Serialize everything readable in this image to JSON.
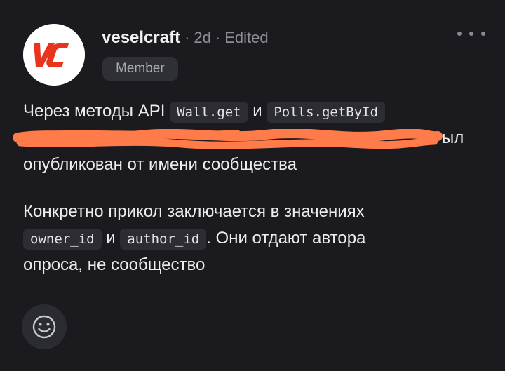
{
  "post": {
    "username": "veselcraft",
    "time": "2d",
    "edited": "Edited",
    "separator": "·",
    "role_badge": "Member",
    "avatar_logo_text": "VC",
    "body": {
      "line1_prefix": "Через методы API",
      "code_wall_get": "Wall.get",
      "and_1": "и",
      "code_polls_get": "Polls.getById",
      "line2_visible_tail": "ыл",
      "line3": "опубликован от имени сообщества",
      "para2_line1": "Конкретно прикол заключается в значениях",
      "code_owner_id": "owner_id",
      "and_2": "и",
      "code_author_id": "author_id",
      "para2_line2_suffix": ". Они отдают автора",
      "para2_line3": "опроса, не сообщество"
    },
    "icons": {
      "more": "more-horizontal-icon",
      "reaction": "smiley-face-icon"
    },
    "colors": {
      "background": "#1b1b1f",
      "redaction": "#ff7b4a",
      "logo_red": "#e8341c"
    }
  }
}
